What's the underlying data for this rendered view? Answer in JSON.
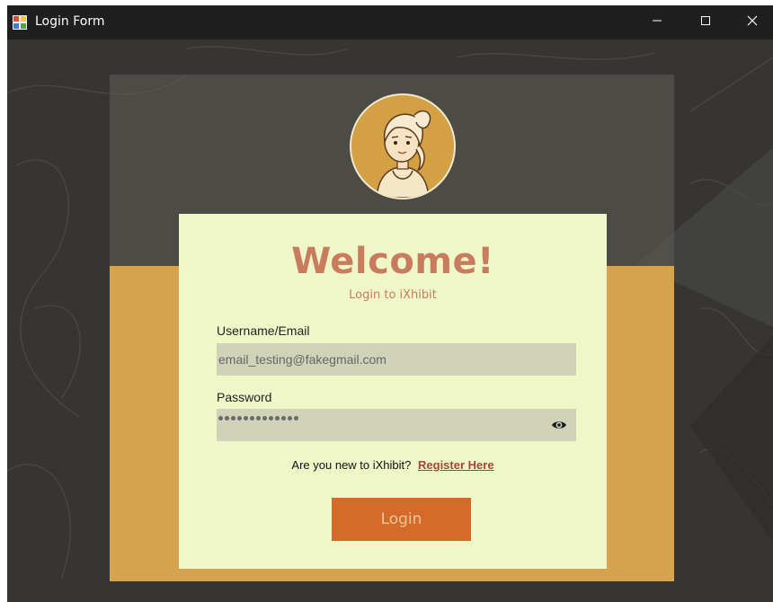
{
  "window": {
    "title": "Login Form",
    "controls": {
      "minimize": "minimize",
      "maximize": "maximize",
      "close": "close"
    }
  },
  "login": {
    "heading": "Welcome!",
    "subtitle": "Login to iXhibit",
    "username_label": "Username/Email",
    "username_value": "email_testing@fakegmail.com",
    "password_label": "Password",
    "password_mask_length": 13,
    "register_prompt": "Are you new to iXhibit?",
    "register_link": "Register Here",
    "login_button": "Login"
  },
  "icons": {
    "app": "app-icon",
    "avatar": "user-avatar-icon",
    "password_toggle": "eye-icon"
  },
  "colors": {
    "accent_gold": "#d6a44e",
    "card_bg": "#eff7c9",
    "heading": "#c97c5d",
    "login_button": "#d56a2a",
    "register_link": "#a2453a"
  }
}
